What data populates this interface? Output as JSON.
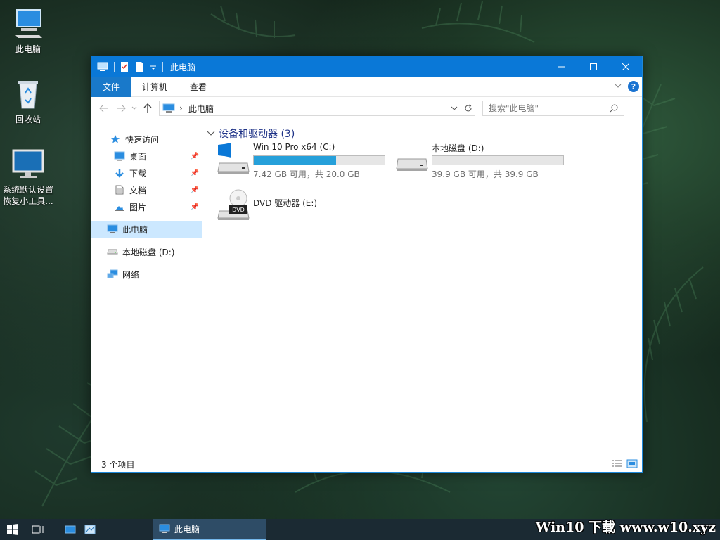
{
  "desktop": {
    "icons": [
      {
        "label": "此电脑"
      },
      {
        "label": "回收站"
      },
      {
        "label": "系统默认设置",
        "label2": "恢复小工具..."
      }
    ]
  },
  "window": {
    "title": "此电脑",
    "tabs": [
      {
        "label": "文件"
      },
      {
        "label": "计算机"
      },
      {
        "label": "查看"
      }
    ],
    "help_label": "?",
    "address": {
      "path": "此电脑"
    },
    "search": {
      "placeholder": "搜索\"此电脑\""
    },
    "nav": {
      "quick_access": "快速访问",
      "quick_items": [
        {
          "label": "桌面"
        },
        {
          "label": "下载"
        },
        {
          "label": "文档"
        },
        {
          "label": "图片"
        }
      ],
      "this_pc": "此电脑",
      "local_disk_d": "本地磁盘 (D:)",
      "network": "网络"
    },
    "group": {
      "title": "设备和驱动器 (3)"
    },
    "drives": [
      {
        "name": "Win 10 Pro x64 (C:)",
        "size": "7.42 GB 可用，共 20.0 GB",
        "used_fraction": 0.629
      },
      {
        "name": "本地磁盘 (D:)",
        "size": "39.9 GB 可用，共 39.9 GB",
        "used_fraction": 0.0
      },
      {
        "name": "DVD 驱动器 (E:)",
        "badge": "DVD"
      }
    ],
    "status": {
      "count": "3 个项目"
    }
  },
  "taskbar": {
    "active_label": "此电脑"
  },
  "watermark": {
    "text": "Win10 下载 www.w10.xyz"
  },
  "colors": {
    "title_blue": "#0a78d7",
    "file_tab": "#1979ca",
    "drive_bar": "#26a0da",
    "selected": "#cce8ff",
    "taskbar": "#1b2a33"
  }
}
